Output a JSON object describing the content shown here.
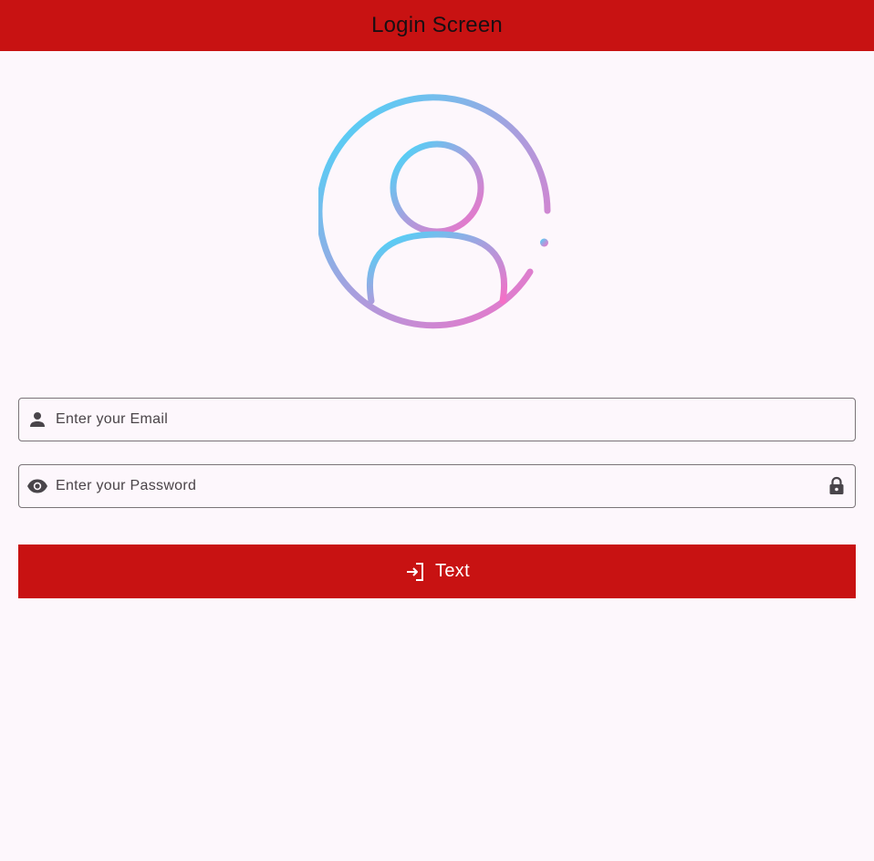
{
  "app_bar": {
    "title": "Login Screen",
    "color": "#c81212"
  },
  "avatar": {
    "icon": "user-circle-icon",
    "gradient": [
      "#3fdcfc",
      "#f56fc6"
    ]
  },
  "email_field": {
    "placeholder": "Enter your Email",
    "value": "",
    "leading_icon": "person-icon"
  },
  "password_field": {
    "placeholder": "Enter your Password",
    "value": "",
    "leading_icon": "eye-icon",
    "trailing_icon": "lock-icon"
  },
  "login_button": {
    "label": "Text",
    "icon": "login-icon",
    "color": "#c81212"
  },
  "colors": {
    "background": "#fdf7fc",
    "field_border": "#7a7478",
    "icon": "#49454a"
  }
}
